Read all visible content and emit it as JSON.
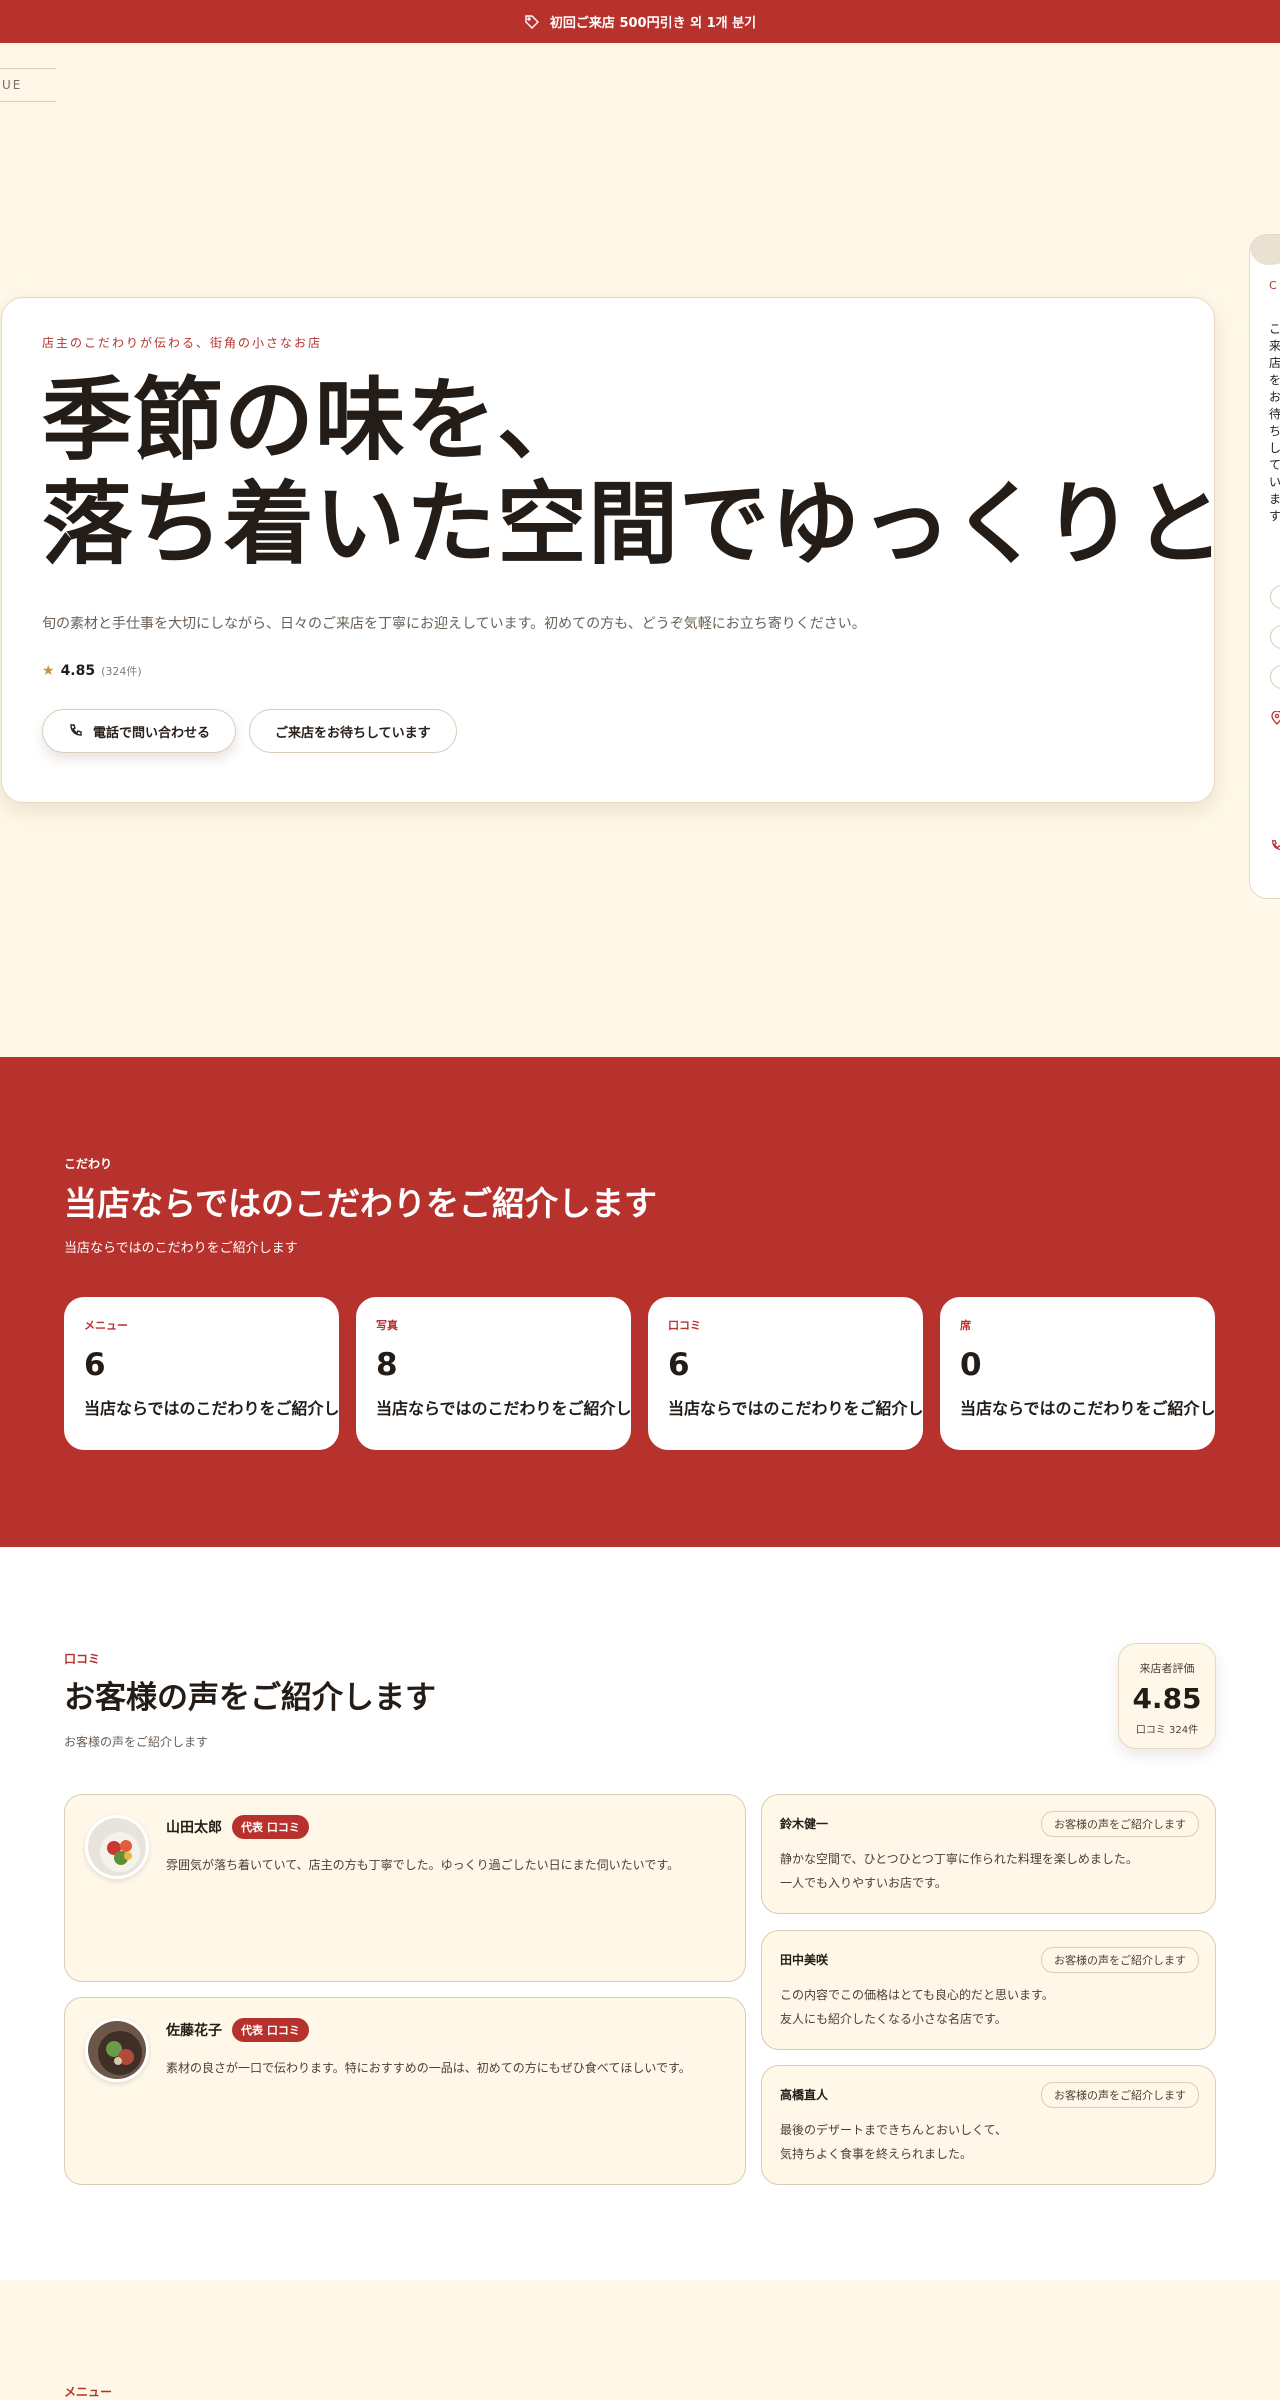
{
  "topbar": {
    "text": "初回ご来店 500円引き 외 1개 분기",
    "icon": "tag-icon"
  },
  "edge_tab": {
    "text": "UE"
  },
  "hero": {
    "kicker": "店主のこだわりが伝わる、街角の小さなお店",
    "title_line1": "季節の味を、",
    "title_line2": "落ち着いた空間でゆっくりと",
    "description": "旬の素材と手仕事を大切にしながら、日々のご来店を丁寧にお迎えしています。初めての方も、どうぞ気軽にお立ち寄りください。",
    "rating": {
      "score": "4.85",
      "count": "(324件)"
    },
    "buttons": {
      "call": "電話で問い合わせる",
      "welcome": "ご来店をお待ちしています"
    }
  },
  "side_peek": {
    "kicker": "C C",
    "text": "こ来店をお待ちしています"
  },
  "commitment": {
    "kicker": "こだわり",
    "title": "当店ならではのこだわりをご紹介します",
    "subtitle": "当店ならではのこだわりをご紹介します",
    "cards": [
      {
        "label": "メニュー",
        "value": "6",
        "text": "当店ならではのこだわりをご紹介します"
      },
      {
        "label": "写真",
        "value": "8",
        "text": "当店ならではのこだわりをご紹介します"
      },
      {
        "label": "口コミ",
        "value": "6",
        "text": "当店ならではのこだわりをご紹介します"
      },
      {
        "label": "席",
        "value": "0",
        "text": "当店ならではのこだわりをご紹介します"
      }
    ]
  },
  "reviews": {
    "kicker": "口コミ",
    "title": "お客様の声をご紹介します",
    "subtitle": "お客様の声をご紹介します",
    "rating_box": {
      "label": "来店者評価",
      "score": "4.85",
      "count": "口コミ 324件"
    },
    "featured": [
      {
        "name": "山田太郎",
        "badge": "代表 口コミ",
        "body": "雰囲気が落ち着いていて、店主の方も丁寧でした。ゆっくり過ごしたい日にまた伺いたいです。"
      },
      {
        "name": "佐藤花子",
        "badge": "代表 口コミ",
        "body": "素材の良さが一口で伝わります。特におすすめの一品は、初めての方にもぜひ食べてほしいです。"
      }
    ],
    "items": [
      {
        "name": "鈴木健一",
        "tag": "お客様の声をご紹介します",
        "body": "静かな空間で、ひとつひとつ丁寧に作られた料理を楽しめました。\n一人でも入りやすいお店です。"
      },
      {
        "name": "田中美咲",
        "tag": "お客様の声をご紹介します",
        "body": "この内容でこの価格はとても良心的だと思います。\n友人にも紹介したくなる小さな名店です。"
      },
      {
        "name": "高橋直人",
        "tag": "お客様の声をご紹介します",
        "body": "最後のデザートまできちんとおいしくて、\n気持ちよく食事を終えられました。"
      }
    ]
  },
  "menu": {
    "kicker": "メニュー"
  },
  "colors": {
    "accent": "#b8322d",
    "cream": "#fff8e8",
    "text": "#241c17"
  }
}
